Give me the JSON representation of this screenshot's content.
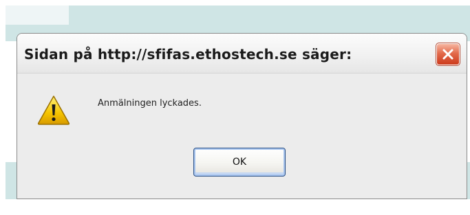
{
  "dialog": {
    "title": "Sidan på http://sfifas.ethostech.se säger:",
    "message": "Anmälningen lyckades.",
    "ok_label": "OK",
    "icon": "warning-icon",
    "close_icon": "close-icon"
  },
  "colors": {
    "page_band": "#cfe5e5",
    "dialog_face": "#ececec",
    "close_button": "#e36b4c",
    "warning_yellow": "#f5c400",
    "ok_border": "#2a4f85"
  }
}
